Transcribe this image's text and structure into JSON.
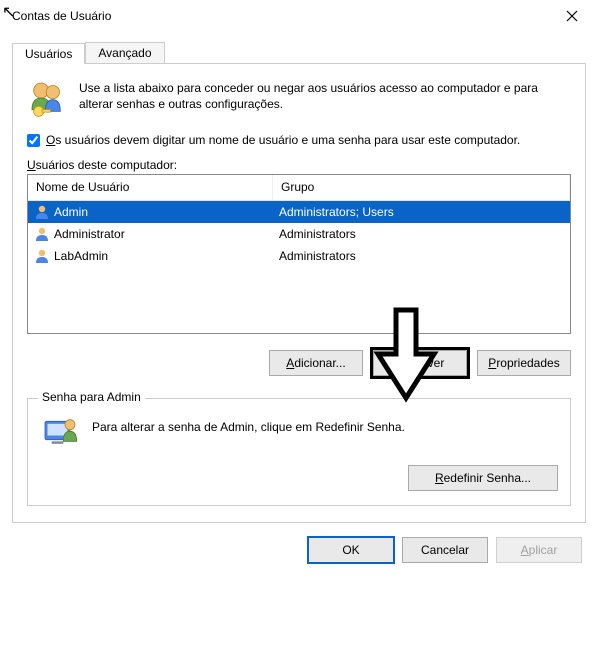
{
  "window": {
    "title": "Contas de Usuário"
  },
  "tabs": [
    {
      "label": "Usuários",
      "active": true
    },
    {
      "label": "Avançado",
      "active": false
    }
  ],
  "intro": {
    "text": "Use a lista abaixo para conceder ou negar aos usuários acesso ao computador e para alterar senhas e outras configurações."
  },
  "checkbox": {
    "checked": true,
    "label_pre": "O",
    "label_rest": "s usuários devem digitar um nome de usuário e uma senha para usar este computador."
  },
  "list": {
    "label_pre": "U",
    "label_rest": "suários deste computador:",
    "columns": {
      "name": "Nome de Usuário",
      "group": "Grupo"
    },
    "rows": [
      {
        "name": "Admin",
        "group": "Administrators; Users",
        "selected": true
      },
      {
        "name": "Administrator",
        "group": "Administrators",
        "selected": false
      },
      {
        "name": "LabAdmin",
        "group": "Administrators",
        "selected": false
      }
    ]
  },
  "buttons": {
    "add_pre": "A",
    "add_rest": "dicionar...",
    "remove_pre": "R",
    "remove_rest": "emover",
    "props_pre": "P",
    "props_rest": "ropriedades"
  },
  "password_group": {
    "title": "Senha para Admin",
    "text": "Para alterar a senha de Admin, clique em Redefinir Senha.",
    "button_pre": "R",
    "button_rest": "edefinir Senha..."
  },
  "footer": {
    "ok": "OK",
    "cancel": "Cancelar",
    "apply_pre": "A",
    "apply_rest": "plicar"
  }
}
